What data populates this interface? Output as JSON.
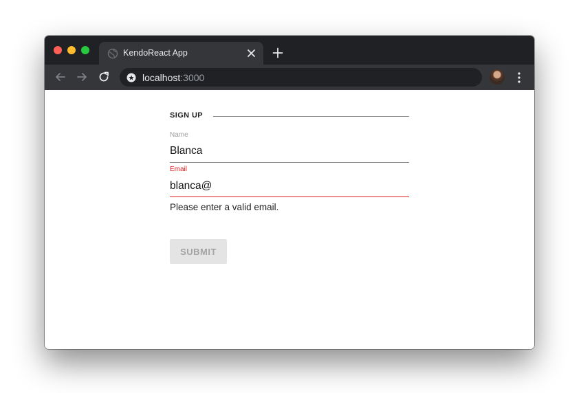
{
  "browser": {
    "tab": {
      "title": "KendoReact App"
    },
    "address": {
      "host": "localhost",
      "port": ":3000"
    }
  },
  "form": {
    "legend": "SIGN UP",
    "name": {
      "label": "Name",
      "value": "Blanca"
    },
    "email": {
      "label": "Email",
      "value": "blanca@",
      "error": "Please enter a valid email."
    },
    "submit_label": "SUBMIT"
  },
  "colors": {
    "error": "#e51a1a",
    "chrome_dark": "#202124",
    "chrome_toolbar": "#35363a",
    "submit_bg": "#e4e4e4"
  },
  "icons": [
    "globe-icon",
    "close-icon",
    "plus-icon",
    "back-icon",
    "forward-icon",
    "reload-icon",
    "site-info-icon",
    "kebab-menu-icon"
  ]
}
